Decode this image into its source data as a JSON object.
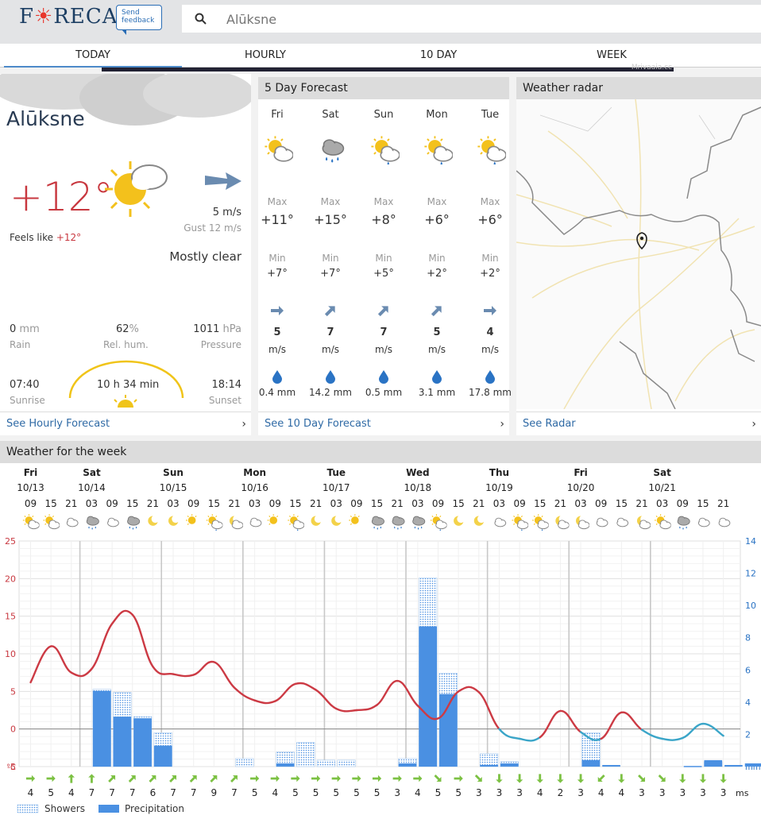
{
  "logo": "FORECA",
  "feedback": "Send feedback",
  "search": {
    "placeholder": "Alūksne"
  },
  "tabs": [
    "TODAY",
    "HOURLY",
    "10 DAY",
    "WEEK"
  ],
  "ad_text": "Mrivaaia.cc",
  "current": {
    "city": "Alūksne",
    "temp": "+12°",
    "feels_label": "Feels like",
    "feels_value": "+12°",
    "wind": "5 m/s",
    "gust": "Gust 12 m/s",
    "condition": "Mostly clear",
    "rain_value": "0",
    "rain_unit": "mm",
    "rain_label": "Rain",
    "hum_value": "62",
    "hum_unit": "%",
    "hum_label": "Rel. hum.",
    "pressure_value": "1011",
    "pressure_unit": "hPa",
    "pressure_label": "Pressure",
    "sunrise": "07:40",
    "sunrise_label": "Sunrise",
    "daylength": "10 h 34 min",
    "sunset": "18:14",
    "sunset_label": "Sunset",
    "link": "See Hourly Forecast"
  },
  "five_day": {
    "title": "5 Day Forecast",
    "max_label": "Max",
    "min_label": "Min",
    "unit": "m/s",
    "link": "See 10 Day Forecast",
    "days": [
      {
        "name": "Fri",
        "icon": "sun-cloud",
        "max": "+11°",
        "min": "+7°",
        "wind": "5",
        "wdir": 90,
        "precip": "0.4 mm"
      },
      {
        "name": "Sat",
        "icon": "cloud-rain",
        "max": "+15°",
        "min": "+7°",
        "wind": "7",
        "wdir": 45,
        "precip": "14.2 mm"
      },
      {
        "name": "Sun",
        "icon": "sun-cloud-rain",
        "max": "+8°",
        "min": "+5°",
        "wind": "7",
        "wdir": 45,
        "precip": "0.5 mm"
      },
      {
        "name": "Mon",
        "icon": "sun-cloud-rain",
        "max": "+6°",
        "min": "+2°",
        "wind": "5",
        "wdir": 45,
        "precip": "3.1 mm"
      },
      {
        "name": "Tue",
        "icon": "sun-cloud-rain",
        "max": "+6°",
        "min": "+2°",
        "wind": "4",
        "wdir": 90,
        "precip": "17.8 mm"
      }
    ]
  },
  "radar": {
    "title": "Weather radar",
    "link": "See Radar"
  },
  "week": {
    "title": "Weather for the week",
    "days": [
      {
        "name": "Fri",
        "date": "10/13"
      },
      {
        "name": "Sat",
        "date": "10/14"
      },
      {
        "name": "Sun",
        "date": "10/15"
      },
      {
        "name": "Mon",
        "date": "10/16"
      },
      {
        "name": "Tue",
        "date": "10/17"
      },
      {
        "name": "Wed",
        "date": "10/18"
      },
      {
        "name": "Thu",
        "date": "10/19"
      },
      {
        "name": "Fri",
        "date": "10/20"
      },
      {
        "name": "Sat",
        "date": "10/21"
      }
    ],
    "legend_showers": "Showers",
    "legend_precip": "Precipitation",
    "wind_unit": "ms"
  },
  "chart_data": {
    "type": "line",
    "left_axis_unit": "°C",
    "right_axis_unit": "mm",
    "left_ylim": [
      -5,
      25
    ],
    "left_ticks": [
      "25",
      "20",
      "15",
      "10",
      "5",
      "0",
      "-5"
    ],
    "right_ylim": [
      0,
      14
    ],
    "right_ticks": [
      "14",
      "12",
      "10",
      "8",
      "6",
      "4",
      "2"
    ],
    "hours": [
      "09",
      "15",
      "21",
      "03",
      "09",
      "15",
      "21",
      "03",
      "09",
      "15",
      "21",
      "03",
      "09",
      "15",
      "21",
      "03",
      "09",
      "15",
      "21",
      "03",
      "09",
      "15",
      "21",
      "03",
      "09",
      "15",
      "21",
      "03",
      "09",
      "15",
      "21",
      "03",
      "09",
      "15",
      "21"
    ],
    "icons": [
      "sun-cloud",
      "sun-cloud",
      "cloud",
      "cloud-rain",
      "cloud",
      "cloud-rain",
      "moon",
      "moon",
      "sun",
      "sun-cloud-rain",
      "moon-cloud",
      "cloud",
      "sun",
      "sun-cloud-rain",
      "moon",
      "moon",
      "sun",
      "cloud-rain",
      "cloud-rain",
      "cloud-rain",
      "sun-cloud-rain",
      "moon",
      "moon",
      "cloud",
      "sun-cloud-rain",
      "sun-cloud-rain",
      "moon-cloud",
      "moon-cloud",
      "cloud",
      "cloud",
      "moon-cloud",
      "sun-cloud",
      "cloud-rain",
      "cloud",
      "cloud"
    ],
    "temperature": [
      6.2,
      11,
      7.5,
      8,
      14,
      15.2,
      8.3,
      7.3,
      7.2,
      8.9,
      5.5,
      3.8,
      3.7,
      6,
      5.2,
      2.7,
      2.5,
      3.2,
      6.4,
      3.1,
      1.4,
      5,
      4.9,
      0,
      -1.3,
      -1.1,
      2.4,
      -0.4,
      -1.3,
      2.2,
      -0.1,
      -1.3,
      -1.2,
      0.7,
      -0.9
    ],
    "precipitation": [
      0,
      0,
      0,
      4.7,
      3.1,
      3,
      1.3,
      0,
      0,
      0,
      0,
      0,
      0.2,
      0,
      0,
      0,
      0,
      0,
      0.2,
      8.7,
      4.5,
      0,
      0.1,
      0.2,
      0,
      0,
      0,
      0.4,
      0.1,
      0,
      0,
      0,
      0.04,
      0.4,
      0.1,
      0.2
    ],
    "showers": [
      0,
      0,
      0,
      4.8,
      4.6,
      3.1,
      2.1,
      0,
      0,
      0,
      0.5,
      0,
      0.9,
      1.5,
      0.4,
      0.4,
      0,
      0,
      0.5,
      11.7,
      5.8,
      0,
      0.8,
      0.3,
      0,
      0,
      0,
      2.1,
      0,
      0,
      0,
      0,
      0,
      0.3,
      0,
      0
    ],
    "wind_speed": [
      "4",
      "5",
      "4",
      "7",
      "7",
      "7",
      "6",
      "7",
      "7",
      "9",
      "7",
      "5",
      "4",
      "5",
      "5",
      "5",
      "5",
      "5",
      "3",
      "4",
      "5",
      "5",
      "3",
      "3",
      "3",
      "4",
      "2",
      "3",
      "4",
      "4",
      "3",
      "3",
      "3",
      "3",
      "3"
    ],
    "wind_dir": [
      90,
      90,
      0,
      0,
      45,
      45,
      45,
      45,
      45,
      45,
      45,
      90,
      90,
      90,
      90,
      90,
      90,
      90,
      90,
      90,
      135,
      90,
      135,
      180,
      180,
      180,
      180,
      180,
      225,
      180,
      135,
      135,
      180,
      180,
      180
    ],
    "series_colors": {
      "temp_warm": "#cc3a44",
      "temp_cold": "#3aa5c8",
      "precip": "#4a90e2",
      "wind_arrow": "#7cc143"
    }
  }
}
